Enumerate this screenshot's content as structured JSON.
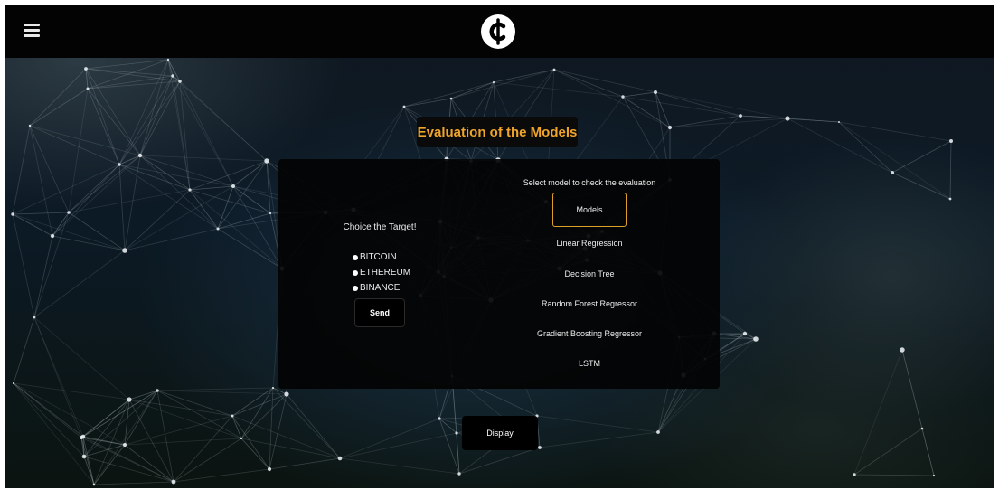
{
  "header": {
    "menu_icon": "hamburger-menu-icon",
    "logo_icon": "crypto-coin-logo",
    "logo_glyph": "¢"
  },
  "evaluation": {
    "title": "Evaluation of the Models"
  },
  "target_selection": {
    "label": "Choice the Target!",
    "options": [
      "BITCOIN",
      "ETHEREUM",
      "BINANCE"
    ],
    "send_label": "Send"
  },
  "model_selection": {
    "label": "Select model to check the evaluation",
    "dropdown_label": "Models",
    "models": [
      "Linear Regression",
      "Decision Tree",
      "Random Forest Regressor",
      "Gradient Boosting Regressor",
      "LSTM"
    ]
  },
  "display_label": "Display",
  "colors": {
    "accent": "#f0a52a",
    "panel": "#030303",
    "text": "#ececec"
  }
}
